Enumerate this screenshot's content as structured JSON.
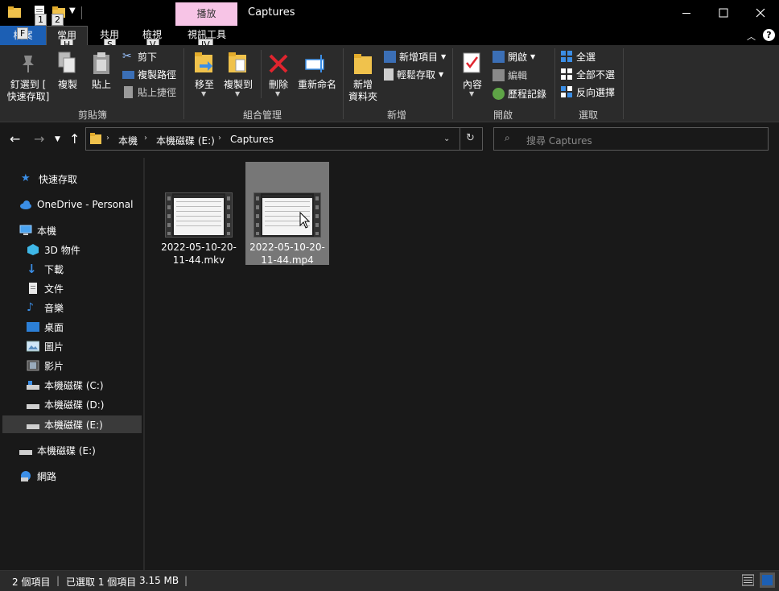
{
  "window": {
    "title": "Captures",
    "contextual_tab_group": "播放",
    "keytips": [
      "1",
      "2"
    ]
  },
  "ribbon_tabs": [
    {
      "label": "檔案",
      "keytip": "F"
    },
    {
      "label": "常用",
      "keytip": "H"
    },
    {
      "label": "共用",
      "keytip": "S"
    },
    {
      "label": "檢視",
      "keytip": "V"
    },
    {
      "label": "視訊工具",
      "keytip": "JV"
    }
  ],
  "ribbon": {
    "clipboard": {
      "label": "剪貼簿",
      "pin_line1": "釘選到 [",
      "pin_line2": "快速存取]",
      "copy": "複製",
      "paste": "貼上",
      "cut": "剪下",
      "copy_path": "複製路徑",
      "paste_shortcut": "貼上捷徑"
    },
    "organize": {
      "label": "組合管理",
      "move_to": "移至",
      "copy_to": "複製到",
      "delete": "刪除",
      "rename": "重新命名"
    },
    "new": {
      "label": "新增",
      "new_folder_line1": "新增",
      "new_folder_line2": "資料夾",
      "new_item": "新增項目",
      "easy_access": "輕鬆存取"
    },
    "open": {
      "label": "開啟",
      "properties": "內容",
      "open": "開啟",
      "edit": "編輯",
      "history": "歷程記錄"
    },
    "select": {
      "label": "選取",
      "select_all": "全選",
      "select_none": "全部不選",
      "invert": "反向選擇"
    }
  },
  "address": {
    "crumbs": [
      "本機",
      "本機磁碟 (E:)",
      "Captures"
    ],
    "search_placeholder": "搜尋 Captures"
  },
  "nav": {
    "quick_access": "快速存取",
    "onedrive": "OneDrive - Personal",
    "this_pc": "本機",
    "items": [
      {
        "label": "3D 物件"
      },
      {
        "label": "下載"
      },
      {
        "label": "文件"
      },
      {
        "label": "音樂"
      },
      {
        "label": "桌面"
      },
      {
        "label": "圖片"
      },
      {
        "label": "影片"
      },
      {
        "label": "本機磁碟 (C:)"
      },
      {
        "label": "本機磁碟 (D:)"
      },
      {
        "label": "本機磁碟 (E:)"
      }
    ],
    "drive_e": "本機磁碟 (E:)",
    "network": "網路"
  },
  "files": [
    {
      "name_line1": "2022-05-10-20-",
      "name_line2": "11-44.mkv",
      "selected": false
    },
    {
      "name_line1": "2022-05-10-20-",
      "name_line2": "11-44.mp4",
      "selected": true
    }
  ],
  "status": {
    "count": "2 個項目",
    "selected": "已選取 1 個項目",
    "size": "3.15 MB"
  },
  "colors": {
    "accent": "#1c5fb4",
    "contextual_tab": "#f7c4e6",
    "selection": "#777777",
    "background": "#191919",
    "ribbon": "#2b2b2b"
  }
}
